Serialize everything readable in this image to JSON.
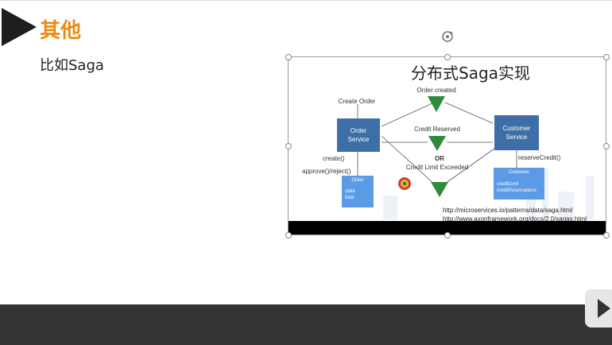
{
  "slide": {
    "title": "其他",
    "subtitle": "比如Saga"
  },
  "diagram": {
    "title": "分布式Saga实现",
    "order_created": "Order created",
    "create_order": "Create Order",
    "credit_reserved": "Credit Reserved",
    "or": "OR",
    "credit_limit_exceeded": "Credit Limit Exceeded",
    "order_service": [
      "Order",
      "Service"
    ],
    "customer_service": [
      "Customer",
      "Service"
    ],
    "create": "create()",
    "approve_reject": "approve()/reject()",
    "reserve_credit": "reserveCredit()",
    "order_box": {
      "title": "Order",
      "lines": [
        "state",
        "total"
      ]
    },
    "customer_box": {
      "title": "Customer",
      "lines": [
        "creditLimit",
        "creditReservations"
      ]
    },
    "links": [
      "http://microservices.io/patterns/data/saga.html",
      "http://www.axonframework.org/docs/2.0/sagas.html"
    ]
  },
  "colors": {
    "accent": "#ec8a14",
    "service_box": "#3d6fa6",
    "entity_box": "#5b9be6",
    "event_triangle": "#2f8a3c"
  },
  "icons": [
    "play-icon",
    "rotate-icon"
  ]
}
